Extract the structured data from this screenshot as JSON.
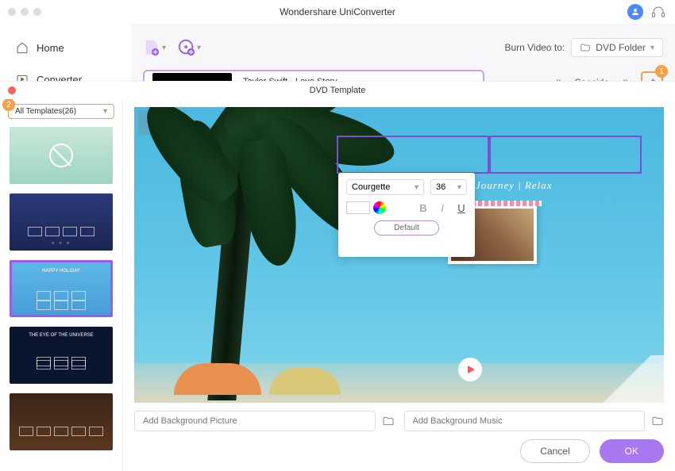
{
  "app": {
    "title": "Wondershare UniConverter"
  },
  "sidebar": {
    "items": [
      {
        "label": "Home",
        "icon": "home-icon"
      },
      {
        "label": "Converter",
        "icon": "converter-icon"
      }
    ]
  },
  "toolbar": {
    "burn_to_label": "Burn Video to:",
    "burn_target": "DVD Folder"
  },
  "track": {
    "title": "Taylor Swift - Love Story"
  },
  "pager": {
    "template_name": "Seaside",
    "edit_badge": "1"
  },
  "modal": {
    "title": "DVD Template",
    "filter_label": "All Templates(26)",
    "filter_badge": "2",
    "templates": [
      {
        "name": "blank-teal"
      },
      {
        "name": "night-moon"
      },
      {
        "name": "happy-holiday",
        "title": "HAPPY HOLIDAY",
        "selected": true
      },
      {
        "name": "eye-universe",
        "title": "THE EYE OF THE UNIVERSE"
      },
      {
        "name": "bourbon"
      }
    ]
  },
  "preview": {
    "subtitle": "Journey  |  Relax"
  },
  "text_format": {
    "font": "Courgette",
    "size": "36",
    "default_label": "Default"
  },
  "inputs": {
    "bg_picture_placeholder": "Add Background Picture",
    "bg_music_placeholder": "Add Background Music"
  },
  "footer": {
    "cancel": "Cancel",
    "ok": "OK"
  }
}
